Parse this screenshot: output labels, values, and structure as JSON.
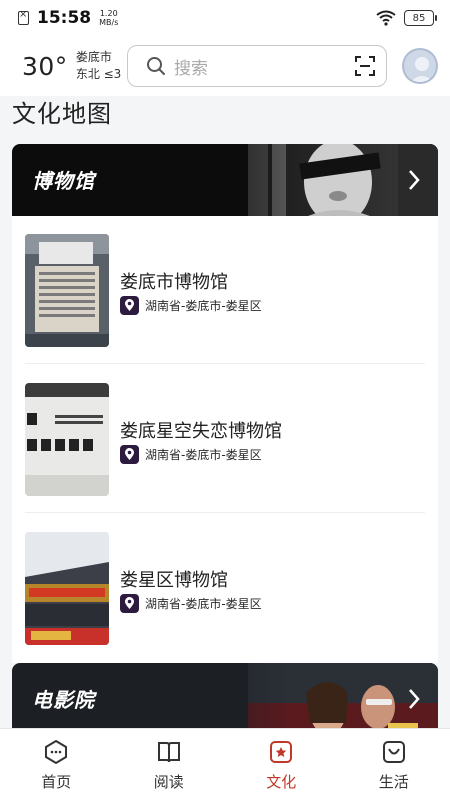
{
  "status_bar": {
    "time": "15:58",
    "net_speed_value": "1.20",
    "net_speed_unit": "MB/s",
    "battery": "85"
  },
  "header": {
    "temperature": "30°",
    "city": "娄底市",
    "wind": "东北 ≤3",
    "search_placeholder": "搜索"
  },
  "section_title": "文化地图",
  "categories": [
    {
      "title": "博物馆"
    },
    {
      "title": "电影院"
    }
  ],
  "museums": [
    {
      "name": "娄底市博物馆",
      "location": "湖南省-娄底市-娄星区"
    },
    {
      "name": "娄底星空失恋博物馆",
      "location": "湖南省-娄底市-娄星区"
    },
    {
      "name": "娄星区博物馆",
      "location": "湖南省-娄底市-娄星区"
    }
  ],
  "bottom_nav": [
    {
      "label": "首页",
      "icon": "home-icon"
    },
    {
      "label": "阅读",
      "icon": "book-icon"
    },
    {
      "label": "文化",
      "icon": "culture-icon",
      "active": true
    },
    {
      "label": "生活",
      "icon": "life-icon"
    }
  ],
  "colors": {
    "active": "#c0392b",
    "loc_icon_bg": "#2d1a3f"
  }
}
